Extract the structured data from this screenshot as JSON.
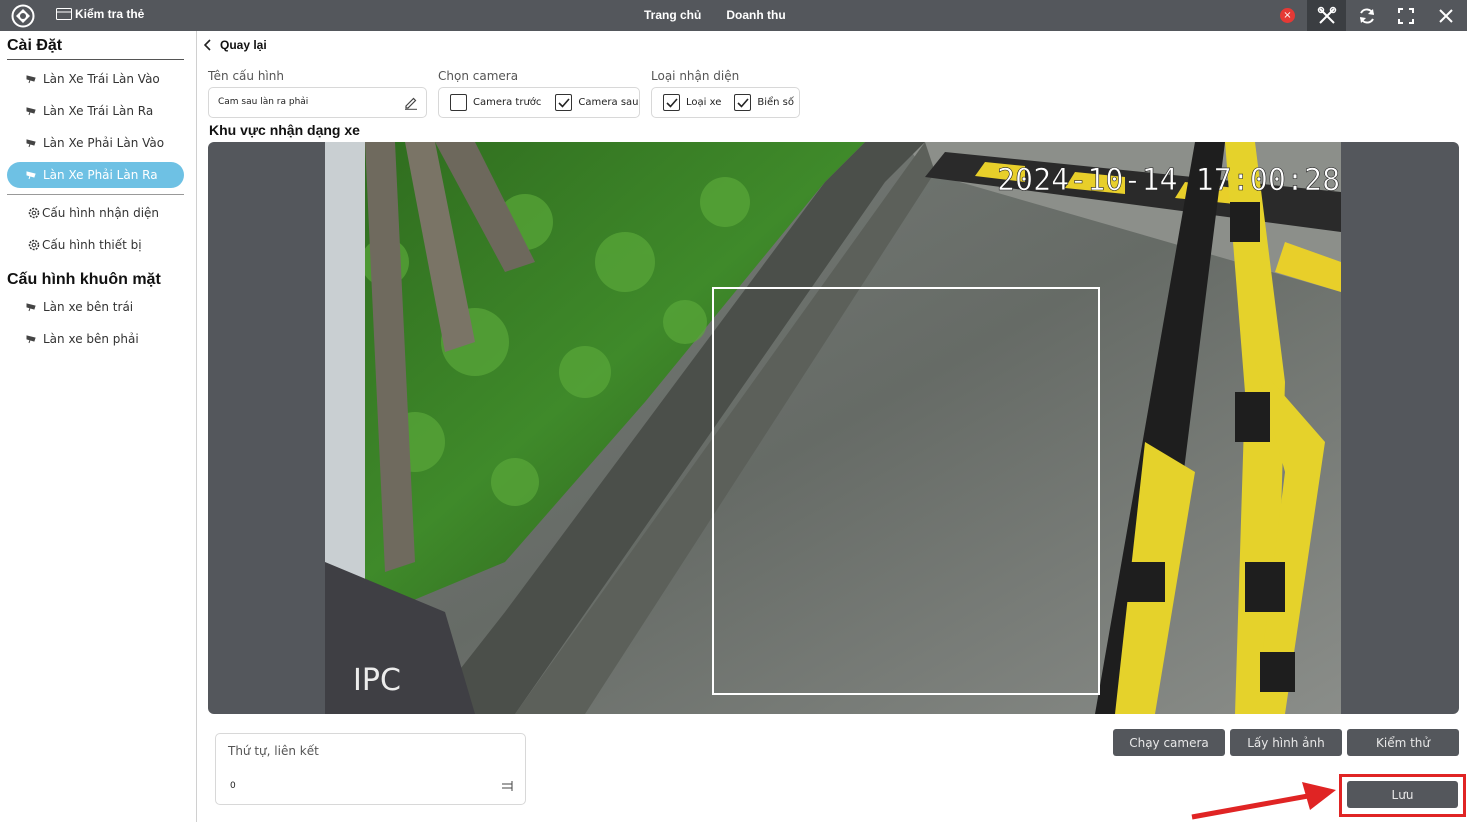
{
  "topbar": {
    "app_title": "Kiểm tra thẻ",
    "nav": [
      "Trang chủ",
      "Doanh thu"
    ],
    "close_badge": "×"
  },
  "sidebar": {
    "section1_title": "Cài Đặt",
    "items": [
      {
        "label": "Làn Xe Trái Làn Vào",
        "icon": "camera-icon"
      },
      {
        "label": "Làn Xe Trái Làn Ra",
        "icon": "camera-icon"
      },
      {
        "label": "Làn Xe Phải Làn Vào",
        "icon": "camera-icon"
      },
      {
        "label": "Làn Xe Phải Làn Ra",
        "icon": "camera-icon",
        "active": true
      }
    ],
    "config_items": [
      {
        "label": "Cấu hình nhận diện",
        "icon": "gear-icon"
      },
      {
        "label": "Cấu hình thiết bị",
        "icon": "gear-icon"
      }
    ],
    "section2_title": "Cấu hình khuôn mặt",
    "face_items": [
      {
        "label": "Làn xe bên trái",
        "icon": "camera-icon"
      },
      {
        "label": "Làn xe bên phải",
        "icon": "camera-icon"
      }
    ]
  },
  "main": {
    "back_label": "Quay lại",
    "config_name": {
      "label": "Tên cấu hình",
      "value": "Cam sau làn ra phải"
    },
    "camera_select": {
      "label": "Chọn camera",
      "options": [
        {
          "label": "Camera trước",
          "checked": false
        },
        {
          "label": "Camera sau",
          "checked": true
        }
      ]
    },
    "recognition_type": {
      "label": "Loại nhận diện",
      "options": [
        {
          "label": "Loại xe",
          "checked": true
        },
        {
          "label": "Biển số",
          "checked": true
        }
      ]
    },
    "zone_title": "Khu vực nhận dạng xe",
    "camera_feed": {
      "timestamp": "2024-10-14 17:00:28",
      "watermark": "IPC"
    },
    "order_field": {
      "label": "Thứ tự, liên kết",
      "value": "0"
    },
    "buttons": {
      "run_camera": "Chạy camera",
      "capture": "Lấy hình ảnh",
      "test": "Kiểm thử",
      "save": "Lưu"
    }
  },
  "colors": {
    "topbar": "#54575c",
    "active_item": "#6ec1e4",
    "highlight": "#e02424",
    "button": "#54575c"
  }
}
